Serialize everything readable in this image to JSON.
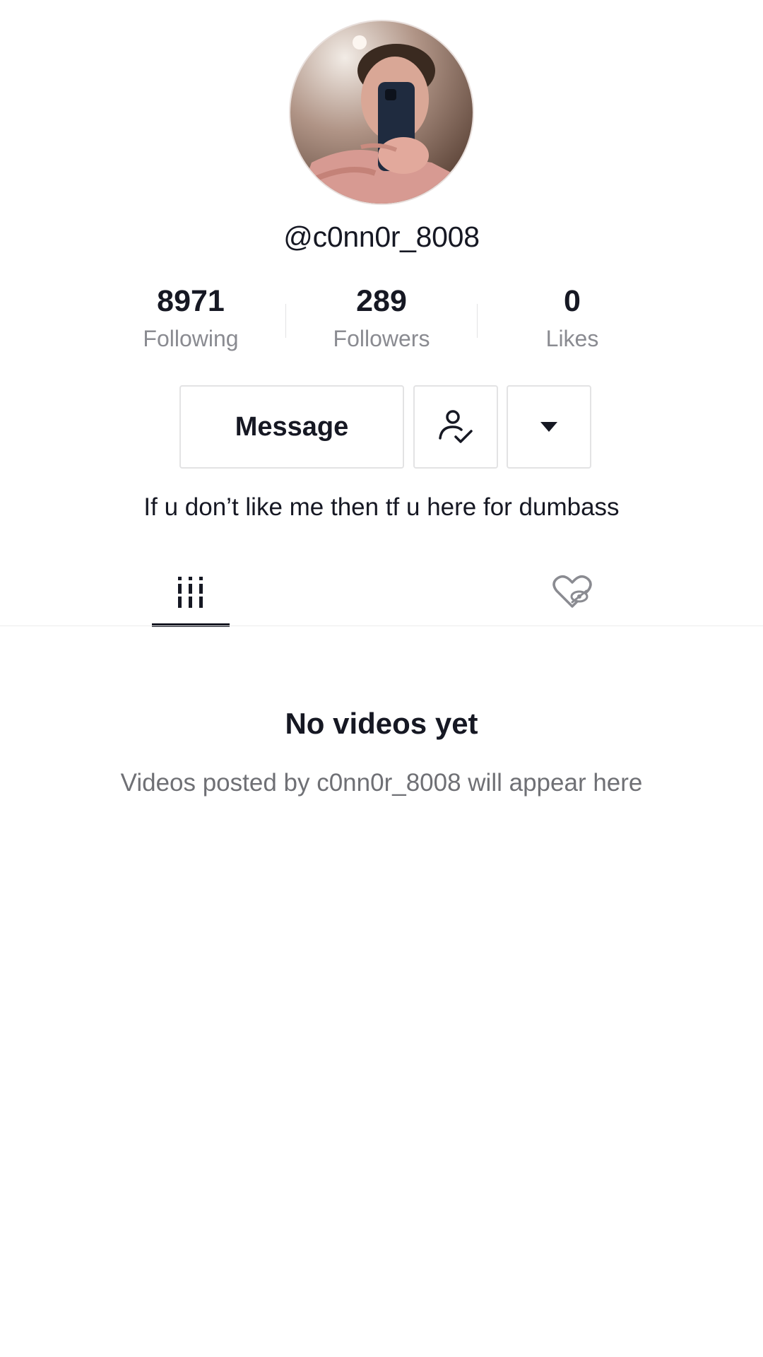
{
  "profile": {
    "username": "@c0nn0r_8008",
    "bio": "If u don’t like me then tf u here for dumbass",
    "avatar_icon": "user-avatar-photo"
  },
  "stats": [
    {
      "value": "8971",
      "label": "Following"
    },
    {
      "value": "289",
      "label": "Followers"
    },
    {
      "value": "0",
      "label": "Likes"
    }
  ],
  "actions": {
    "message_label": "Message",
    "following_icon": "user-check-icon",
    "more_icon": "caret-down-icon"
  },
  "tabs": [
    {
      "name": "videos",
      "icon": "grid-icon",
      "selected": true
    },
    {
      "name": "liked",
      "icon": "hidden-heart-icon",
      "selected": false
    }
  ],
  "empty_state": {
    "title": "No videos yet",
    "subtitle": "Videos posted by c0nn0r_8008 will appear here"
  },
  "colors": {
    "text_primary": "#161823",
    "text_secondary": "#8a8b91",
    "border": "#e3e3e4"
  }
}
